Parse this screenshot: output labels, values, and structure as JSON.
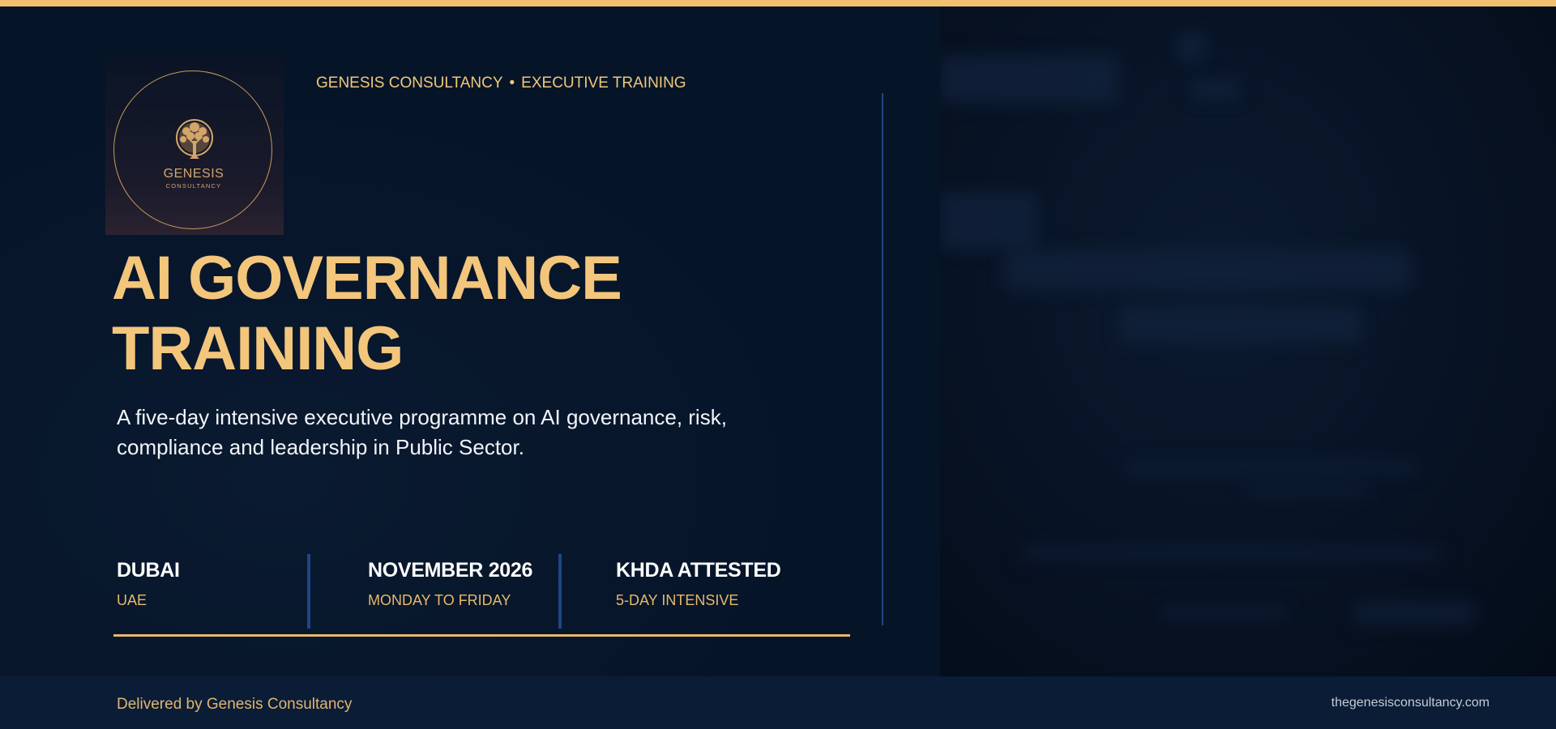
{
  "brand": {
    "logo_name": "GENESIS",
    "logo_sub": "CONSULTANCY",
    "eyebrow_left": "GENESIS CONSULTANCY",
    "eyebrow_sep": "•",
    "eyebrow_right": "EXECUTIVE TRAINING"
  },
  "hero": {
    "title_line1": "AI GOVERNANCE",
    "title_line2": "TRAINING",
    "subtitle": "A five-day intensive executive programme on AI governance, risk, compliance and leadership in Public Sector."
  },
  "info": [
    {
      "title": "DUBAI",
      "sub": "UAE"
    },
    {
      "title": "NOVEMBER 2026",
      "sub": "MONDAY TO FRIDAY"
    },
    {
      "title": "KHDA ATTESTED",
      "sub": "5-DAY INTENSIVE"
    }
  ],
  "footer": {
    "left": "Delivered by Genesis Consultancy",
    "right": "thegenesisconsultancy.com"
  },
  "colors": {
    "background": "#061428",
    "accent_gold": "#f3c67c",
    "divider_blue": "#1d4a80",
    "footer_bg": "#0a1c36"
  }
}
